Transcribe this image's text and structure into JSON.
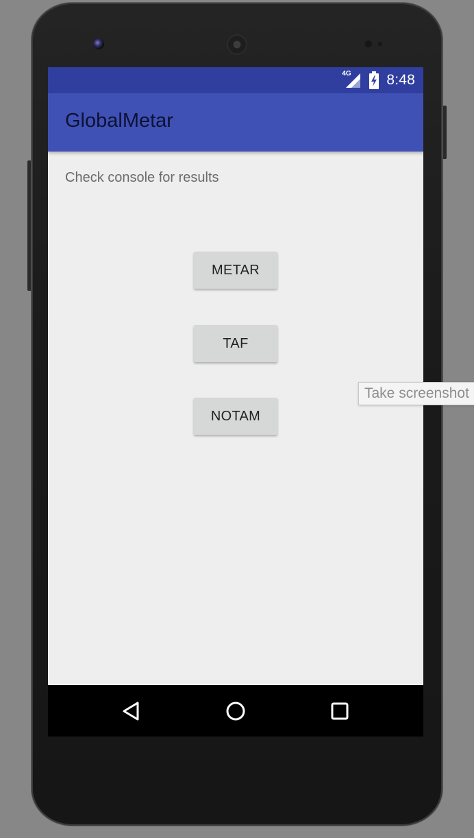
{
  "device": {
    "frame": "phone"
  },
  "status_bar": {
    "network_label": "4G",
    "clock": "8:48",
    "color": "#303f9f",
    "icons": [
      "signal-icon",
      "battery-charging-icon"
    ]
  },
  "app_bar": {
    "title": "GlobalMetar",
    "color": "#3f51b5"
  },
  "main": {
    "message": "Check console for results",
    "buttons": [
      {
        "label": "METAR"
      },
      {
        "label": "TAF"
      },
      {
        "label": "NOTAM"
      }
    ]
  },
  "nav_bar": {
    "icons": [
      "back-icon",
      "home-icon",
      "recents-icon"
    ]
  },
  "tooltip": {
    "text": "Take screenshot"
  }
}
